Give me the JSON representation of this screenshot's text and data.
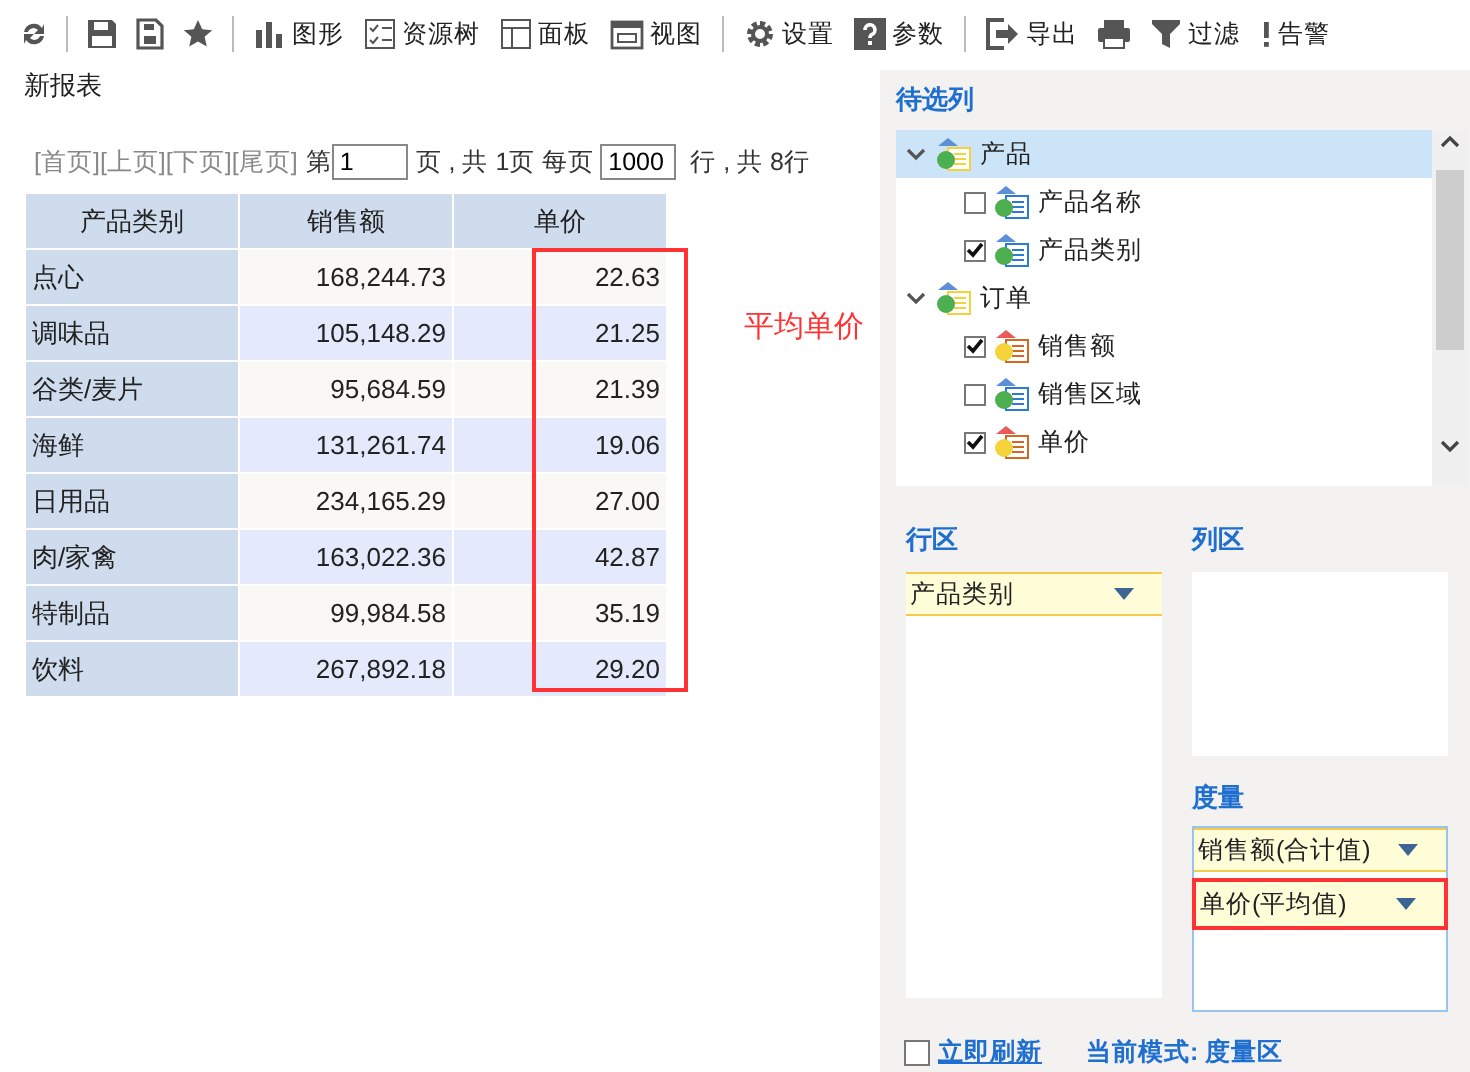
{
  "toolbar": [
    {
      "label": "图形"
    },
    {
      "label": "资源树"
    },
    {
      "label": "面板"
    },
    {
      "label": "视图"
    },
    {
      "label": "设置"
    },
    {
      "label": "参数"
    },
    {
      "label": "导出"
    },
    {
      "label": "过滤"
    },
    {
      "label": "告警"
    }
  ],
  "report": {
    "title": "新报表",
    "pager": {
      "links": [
        {
          "label": "[首页]",
          "disabled": true
        },
        {
          "label": "[上页]",
          "disabled": true
        },
        {
          "label": "[下页]",
          "disabled": true
        },
        {
          "label": "[尾页]",
          "disabled": true
        }
      ],
      "page_prefix": "第",
      "page_value": "1",
      "page_suffix": "页 , 共 1页 每页",
      "rows_value": "1000",
      "rows_suffix": "行 , 共 8行"
    },
    "table": {
      "columns": [
        "产品类别",
        "销售额",
        "单价"
      ],
      "rows": [
        [
          "点心",
          "168,244.73",
          "22.63"
        ],
        [
          "调味品",
          "105,148.29",
          "21.25"
        ],
        [
          "谷类/麦片",
          "95,684.59",
          "21.39"
        ],
        [
          "海鲜",
          "131,261.74",
          "19.06"
        ],
        [
          "日用品",
          "234,165.29",
          "27.00"
        ],
        [
          "肉/家禽",
          "163,022.36",
          "42.87"
        ],
        [
          "特制品",
          "99,984.58",
          "35.19"
        ],
        [
          "饮料",
          "267,892.18",
          "29.20"
        ]
      ]
    },
    "annotation": "平均单价"
  },
  "panel": {
    "candidates_title": "待选列",
    "tree": [
      {
        "label": "产品",
        "kind": "folder",
        "expanded": true,
        "selected": true,
        "children": [
          {
            "label": "产品名称",
            "kind": "dimension",
            "checked": false,
            "selected": false
          },
          {
            "label": "产品类别",
            "kind": "dimension",
            "checked": true,
            "selected": false
          }
        ]
      },
      {
        "label": "订单",
        "kind": "folder",
        "expanded": true,
        "selected": false,
        "children": [
          {
            "label": "销售额",
            "kind": "measure",
            "checked": true,
            "selected": false
          },
          {
            "label": "销售区域",
            "kind": "dimension",
            "checked": false,
            "selected": false
          },
          {
            "label": "单价",
            "kind": "measure",
            "checked": true,
            "selected": false
          }
        ]
      }
    ],
    "rows_title": "行区",
    "rows": [
      "产品类别"
    ],
    "columns_title": "列区",
    "measures_title": "度量",
    "measures": [
      {
        "label": "销售额(合计值)",
        "highlighted": false
      },
      {
        "label": "单价(平均值)",
        "highlighted": true
      }
    ],
    "auto_refresh": {
      "label": "立即刷新",
      "checked": false
    },
    "mode": "当前模式: 度量区"
  }
}
